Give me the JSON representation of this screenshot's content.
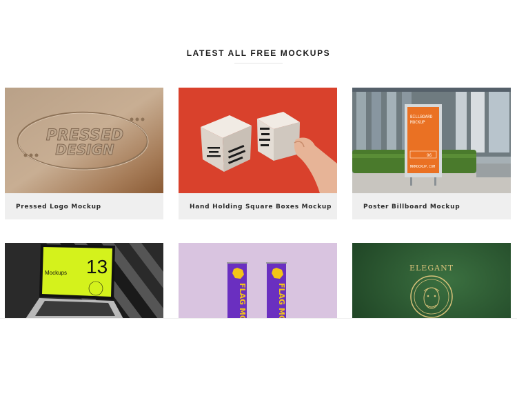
{
  "section": {
    "title": "LATEST ALL FREE MOCKUPS"
  },
  "cards": [
    {
      "caption": "Pressed Logo Mockup",
      "art_line1": "PRESSED",
      "art_line2": "DESIGN"
    },
    {
      "caption": "Hand Holding Square Boxes Mockup"
    },
    {
      "caption": "Poster Billboard Mockup",
      "art_line1": "BILLBOARD",
      "art_line2": "MOCKUP",
      "art_num": "96",
      "art_site": "MRMOCKUP.COM"
    },
    {
      "caption": "",
      "art_small": "Mockups",
      "art_num": "13"
    },
    {
      "caption": "",
      "art_text": "FLAG MOCKUP"
    },
    {
      "caption": "",
      "art_text": "ELEGANT"
    }
  ],
  "colors": {
    "card_bg": "#efefef",
    "box_red": "#d9412c",
    "poster_orange": "#e8702a",
    "laptop_neon": "#d4f21c",
    "flag_purple": "#6a2fc0",
    "flag_yellow": "#f2c518",
    "lilac_bg": "#d9c4e0",
    "elegant_green": "#2a5a32"
  }
}
